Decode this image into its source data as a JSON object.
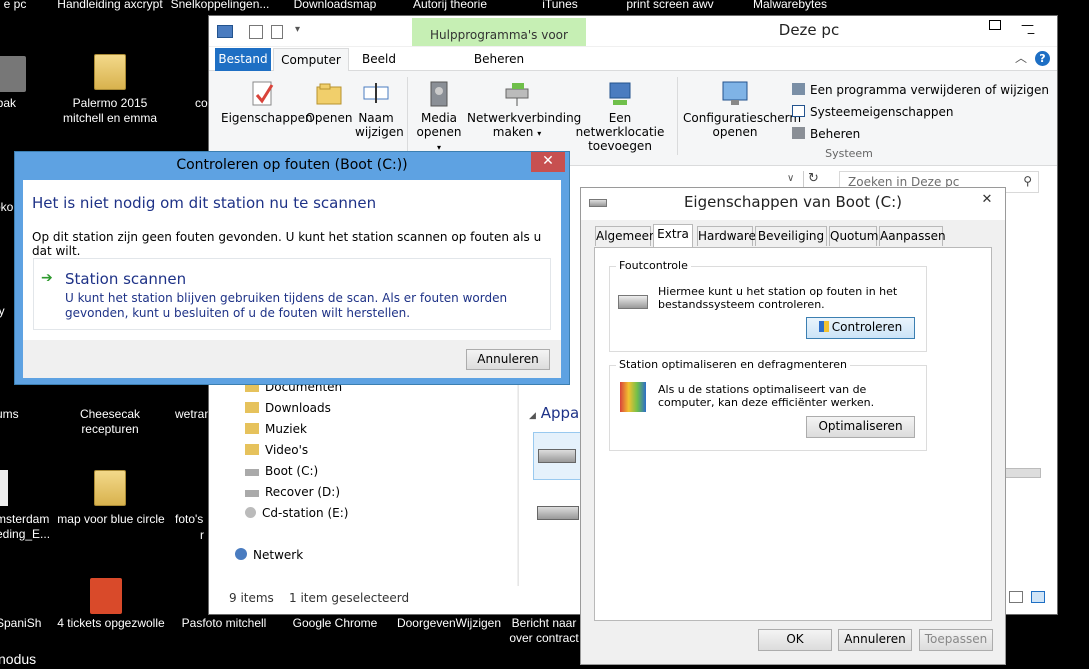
{
  "desktop": {
    "top_labels": [
      "e pc",
      "Handleiding axcrypt",
      "Snelkoppelingen...",
      "Downloadsmap",
      "Autorij theorie",
      "iTunes",
      "print screen awv contract geteke...",
      "Malwarebytes Anti-Malware"
    ],
    "icons": [
      {
        "label": "nbak"
      },
      {
        "label": "Palermo 2015 mitchell en emma"
      },
      {
        "label": "co"
      },
      {
        "label": "oko"
      },
      {
        "label": "ly f"
      },
      {
        "label": "ums"
      },
      {
        "label": "Cheesecak recepturen"
      },
      {
        "label": "wetran"
      },
      {
        "label": "msterdam eding_E..."
      },
      {
        "label": "map voor blue circle"
      },
      {
        "label": "foto's"
      },
      {
        "label": "r"
      },
      {
        "label": "SpaniSh"
      },
      {
        "label": "4 tickets opgezwolle"
      },
      {
        "label": "Pasfoto mitchell"
      },
      {
        "label": "Google Chrome"
      },
      {
        "label": "DoorgevenWijzigen"
      },
      {
        "label": "Bericht naar over contract"
      },
      {
        "label": "nodus"
      }
    ]
  },
  "explorer": {
    "title": "Deze pc",
    "contextual_tab_group": "Hulpprogramma's voor stations",
    "tabs": [
      "Bestand",
      "Computer",
      "Beeld",
      "Beheren"
    ],
    "ribbon": {
      "buttons": [
        "Eigenschappen",
        "Openen",
        "Naam wijzigen",
        "Media openen",
        "Netwerkverbinding maken",
        "Een netwerklocatie toevoegen",
        "Configuratiescherm openen"
      ],
      "system_links": [
        "Een programma verwijderen of wijzigen",
        "Systeemeigenschappen",
        "Beheren"
      ],
      "group_system": "Systeem"
    },
    "search_placeholder": "Zoeken in Deze pc",
    "nav": [
      "Documenten",
      "Downloads",
      "Muziek",
      "Video's",
      "Boot (C:)",
      "Recover (D:)",
      "Cd-station (E:)",
      "Netwerk"
    ],
    "section_devices": "Appar",
    "status_items": "9 items",
    "status_selected": "1 item geselecteerd"
  },
  "check_dialog": {
    "title": "Controleren op fouten (Boot (C:))",
    "heading": "Het is niet nodig om dit station nu te scannen",
    "message": "Op dit station zijn geen fouten gevonden. U kunt het station scannen op fouten als u dat wilt.",
    "option_title": "Station scannen",
    "option_desc": "U kunt het station blijven gebruiken tijdens de scan. Als er fouten worden gevonden, kunt u besluiten of u de fouten wilt herstellen.",
    "cancel": "Annuleren",
    "close": "✕"
  },
  "props_dialog": {
    "title": "Eigenschappen van Boot (C:)",
    "tabs": [
      "Algemeen",
      "Extra",
      "Hardware",
      "Beveiliging",
      "Quotum",
      "Aanpassen"
    ],
    "group1_title": "Foutcontrole",
    "group1_text": "Hiermee kunt u het station op fouten in het bestandssysteem controleren.",
    "group1_button": "Controleren",
    "group2_title": "Station optimaliseren en defragmenteren",
    "group2_text": "Als u de stations optimaliseert van de computer, kan deze efficiënter werken.",
    "group2_button": "Optimaliseren",
    "ok": "OK",
    "cancel": "Annuleren",
    "apply": "Toepassen",
    "close": "✕"
  },
  "colors": {
    "accent": "#1e6fc4",
    "close_red": "#c75050",
    "contextual": "#c6efb4",
    "heading_blue": "#1e3287"
  }
}
